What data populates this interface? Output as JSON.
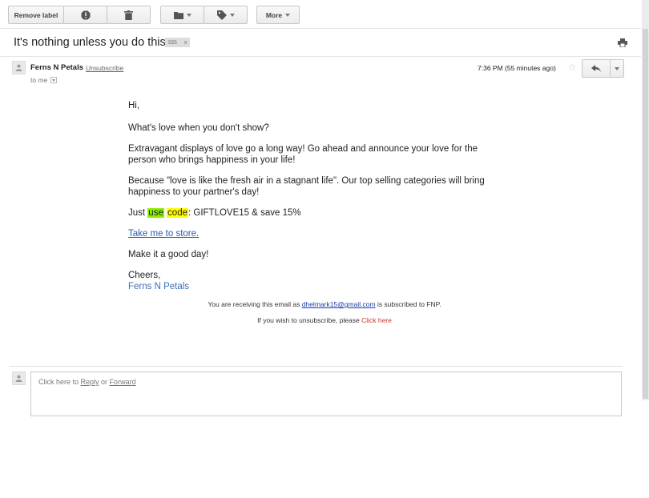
{
  "toolbar": {
    "remove_label": "Remove label",
    "more_label": "More"
  },
  "subject": {
    "title": "It's nothing unless you do this..",
    "label_chip": "555",
    "label_remove": "x"
  },
  "message": {
    "sender": "Ferns N Petals",
    "unsubscribe": "Unsubscribe",
    "to": "to me",
    "time": "7:36 PM (55 minutes ago)",
    "star": "☆"
  },
  "body": {
    "greeting": "Hi,",
    "p1": "What's love when you don't show?",
    "p2_line1": "Extravagant displays of love go a long way! Go ahead and announce your love for the",
    "p2_line2": "person who brings happiness in your life!",
    "p3_line1": "Because \"love is like the fresh air in a stagnant life\". Our top selling categories will bring",
    "p3_line2": "happiness to your partner's day!",
    "code_prefix": "Just ",
    "code_word1": "use",
    "code_word2": "code",
    "code_suffix": ": GIFTLOVE15 & save 15%",
    "store_link": "Take me to store.",
    "closing": "Make it a good day!",
    "cheers": "Cheers,",
    "signature": "Ferns N Petals"
  },
  "footer": {
    "line1_prefix": "You are receiving this email as ",
    "email": "dhelmark15@gmail.com",
    "line1_suffix": " is subscribed to FNP.",
    "line2_prefix": "If you wish to unsubscribe, please ",
    "click_here": "Click here"
  },
  "reply": {
    "prefix": "Click here to ",
    "reply": "Reply",
    "or": " or ",
    "forward": "Forward"
  }
}
